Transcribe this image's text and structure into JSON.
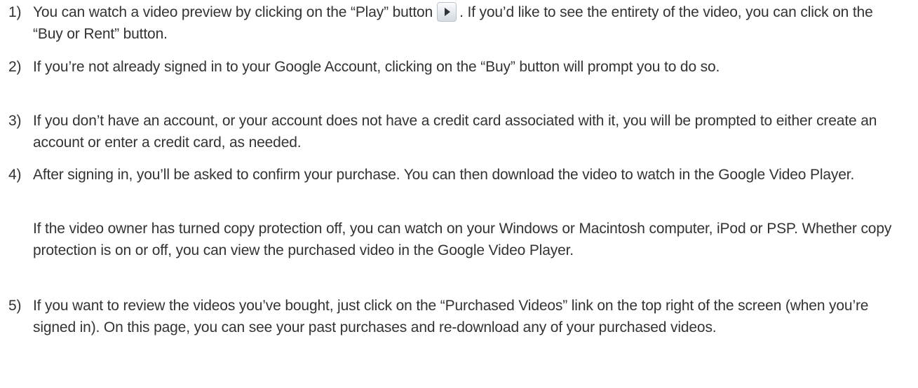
{
  "steps": [
    {
      "number": "1)",
      "text_before_icon": "You can watch a video preview by clicking on the “Play” button",
      "icon": "play-icon",
      "text_after_icon": ". If you’d like to see the entirety of the video, you can click on the “Buy or Rent” button."
    },
    {
      "number": "2)",
      "text": "If you’re not already signed in to your Google Account, clicking on the “Buy” button will prompt you to do so."
    },
    {
      "number": "3)",
      "text": "If you don’t have an account, or your account does not have a credit card associated with it, you will be prompted to either create an account or enter a credit card, as needed."
    },
    {
      "number": "4)",
      "text": "After signing in, you’ll be asked to confirm your purchase. You can then download the video to watch in the Google Video Player.",
      "note": "If the video owner has turned copy protection off, you can watch on your Windows or Macintosh computer, iPod or PSP. Whether copy protection is on or off, you can view the purchased video in the Google Video Player."
    },
    {
      "number": "5)",
      "text": "If you want to review the videos you’ve bought, just click on the “Purchased Videos” link on the top right of the screen (when you’re signed in). On this page, you can see your past purchases and re-download any of your purchased videos."
    }
  ]
}
